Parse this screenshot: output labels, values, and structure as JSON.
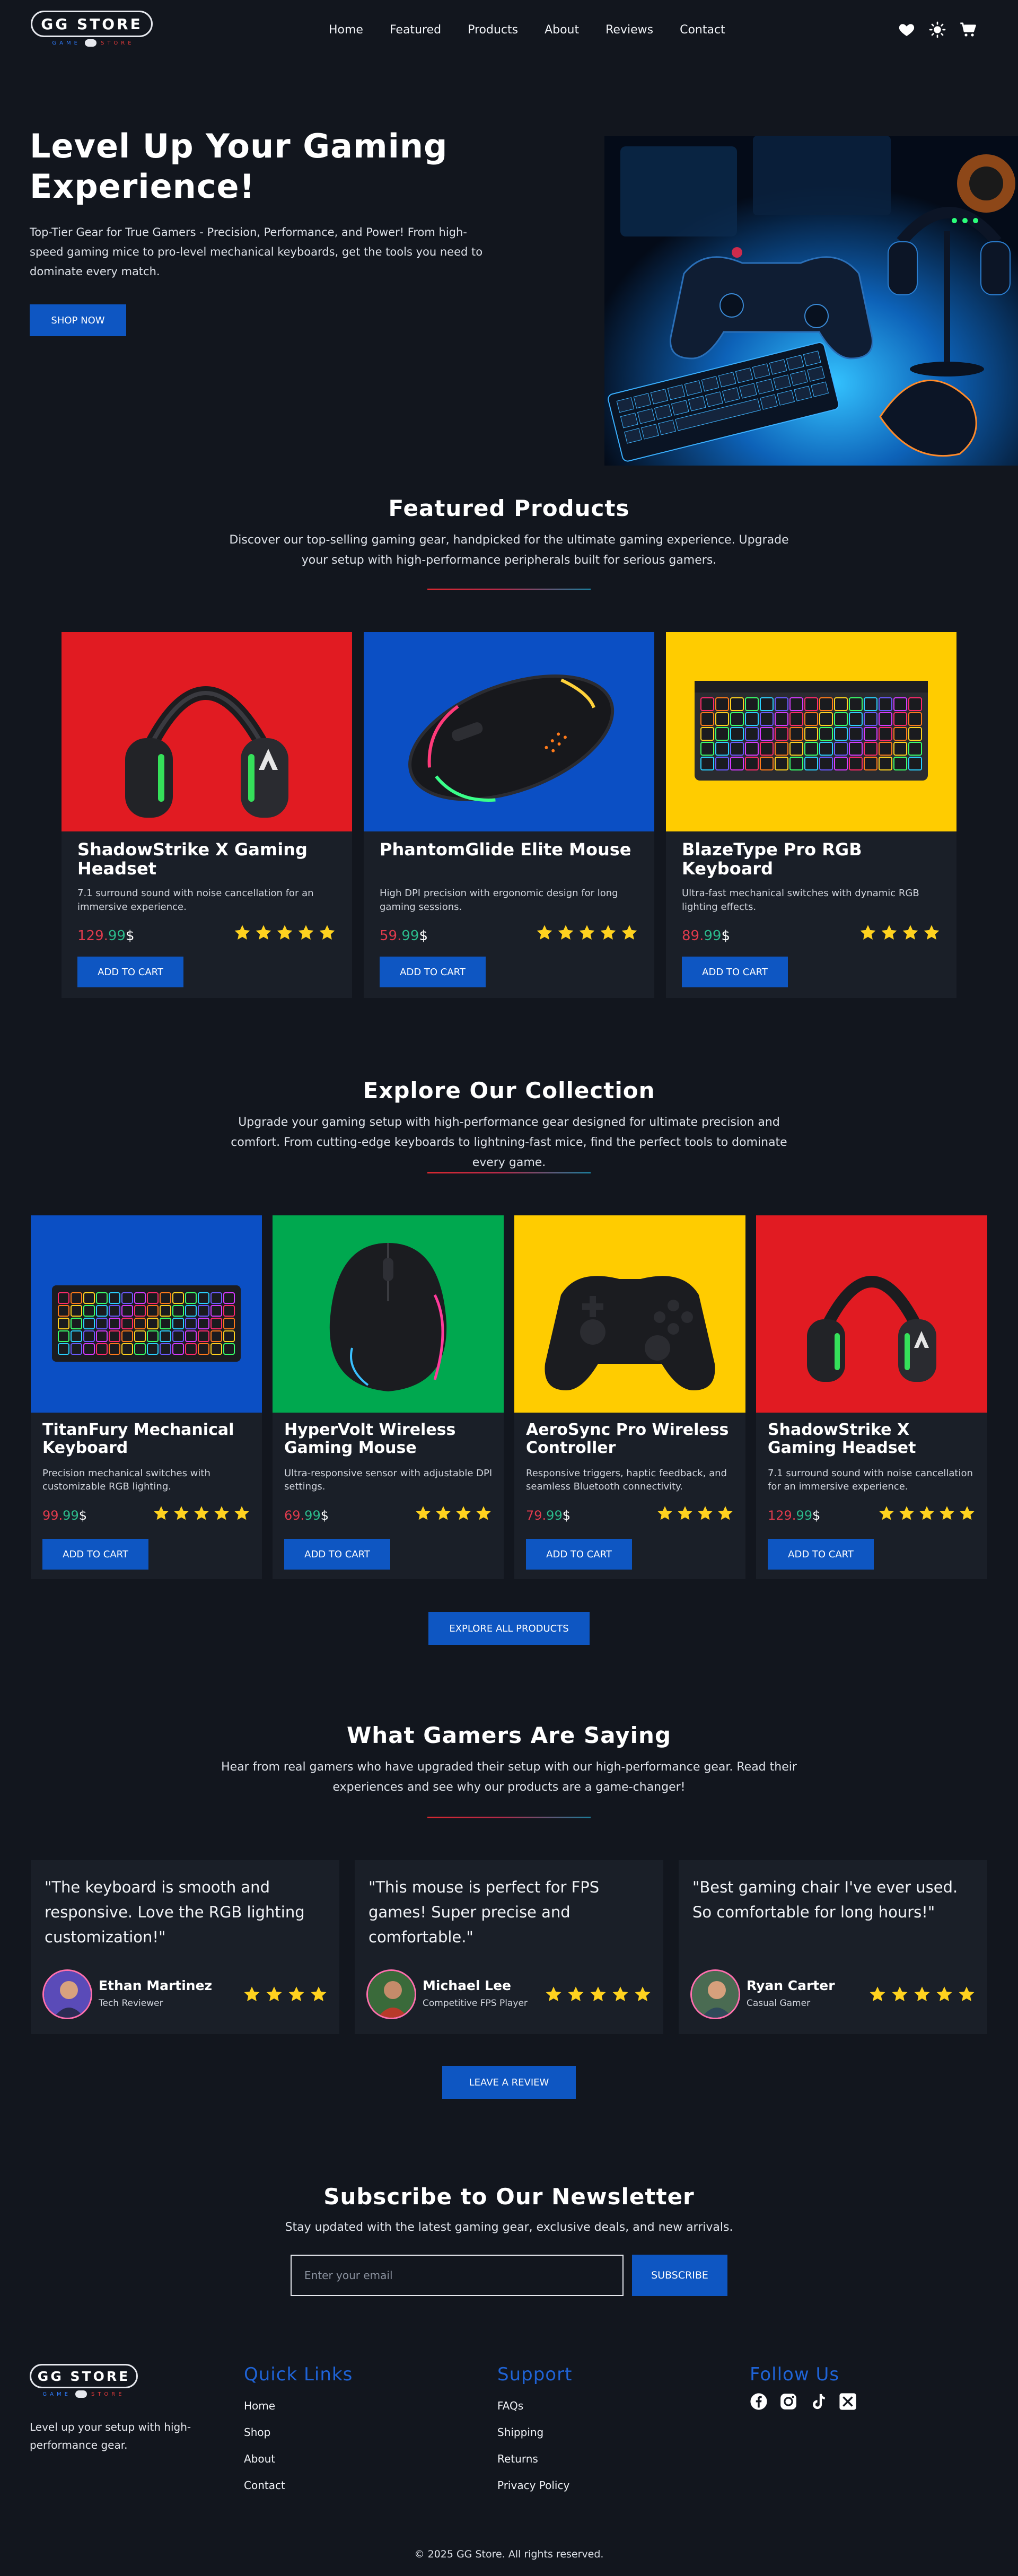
{
  "brand": {
    "name": "GG STORE",
    "sub_left": "GAME",
    "sub_right": "STORE"
  },
  "nav": {
    "links": [
      "Home",
      "Featured",
      "Products",
      "About",
      "Reviews",
      "Contact"
    ],
    "icons": [
      "heart-icon",
      "sun-icon",
      "cart-icon"
    ]
  },
  "hero": {
    "title": "Level Up Your Gaming Experience!",
    "description": "Top-Tier Gear for True Gamers - Precision, Performance, and Power! From high-speed gaming mice to pro-level mechanical keyboards, get the tools you need to dominate every match.",
    "button": "SHOP NOW"
  },
  "featured": {
    "title": "Featured Products",
    "description": "Discover our top-selling gaming gear, handpicked for the ultimate gaming experience. Upgrade your setup with high-performance peripherals built for serious gamers.",
    "products": [
      {
        "name": "ShadowStrike X Gaming Headset",
        "desc": "7.1 surround sound with noise cancellation for an immersive experience.",
        "price_int": "129.",
        "price_dec": "99",
        "currency": "$",
        "stars": 5,
        "button": "ADD TO CART",
        "bg": "#e11b22",
        "product_icon": "headset"
      },
      {
        "name": "PhantomGlide Elite Mouse",
        "desc": "High DPI precision with ergonomic design for long gaming sessions.",
        "price_int": "59.",
        "price_dec": "99",
        "currency": "$",
        "stars": 5,
        "button": "ADD TO CART",
        "bg": "#0b4fc4",
        "product_icon": "mouse"
      },
      {
        "name": "BlazeType Pro RGB Keyboard",
        "desc": "Ultra-fast mechanical switches with dynamic RGB lighting effects.",
        "price_int": "89.",
        "price_dec": "99",
        "currency": "$",
        "stars": 4,
        "button": "ADD TO CART",
        "bg": "#ffcc00",
        "product_icon": "keyboard"
      }
    ]
  },
  "collection": {
    "title": "Explore Our Collection",
    "description": "Upgrade your gaming setup with high-performance gear designed for ultimate precision and comfort. From cutting-edge keyboards to lightning-fast mice, find the perfect tools to dominate every game.",
    "products": [
      {
        "name": "TitanFury Mechanical Keyboard",
        "desc": "Precision mechanical switches with customizable RGB lighting.",
        "price_int": "99.",
        "price_dec": "99",
        "currency": "$",
        "stars": 5,
        "button": "ADD TO CART",
        "bg": "#0b4fc4",
        "product_icon": "keyboard"
      },
      {
        "name": "HyperVolt Wireless Gaming Mouse",
        "desc": "Ultra-responsive sensor with adjustable DPI settings.",
        "price_int": "69.",
        "price_dec": "99",
        "currency": "$",
        "stars": 4,
        "button": "ADD TO CART",
        "bg": "#00a84f",
        "product_icon": "mouse2"
      },
      {
        "name": "AeroSync Pro Wireless Controller",
        "desc": "Responsive triggers, haptic feedback, and seamless Bluetooth connectivity.",
        "price_int": "79.",
        "price_dec": "99",
        "currency": "$",
        "stars": 4,
        "button": "ADD TO CART",
        "bg": "#ffcc00",
        "product_icon": "controller"
      },
      {
        "name": "ShadowStrike X Gaming Headset",
        "desc": "7.1 surround sound with noise cancellation for an immersive experience.",
        "price_int": "129.",
        "price_dec": "99",
        "currency": "$",
        "stars": 5,
        "button": "ADD TO CART",
        "bg": "#e11b22",
        "product_icon": "headset"
      }
    ],
    "button": "EXPLORE ALL PRODUCTS"
  },
  "reviews": {
    "title": "What Gamers Are Saying",
    "description": "Hear from real gamers who have upgraded their setup with our high-performance gear. Read their experiences and see why our products are a game-changer!",
    "items": [
      {
        "quote": "\"The keyboard is smooth and responsive. Love the RGB lighting customization!\"",
        "name": "Ethan Martinez",
        "role": "Tech Reviewer",
        "stars": 4,
        "avatar_color": "#5a4bb8"
      },
      {
        "quote": "\"This mouse is perfect for FPS games! Super precise and comfortable.\"",
        "name": "Michael Lee",
        "role": "Competitive FPS Player",
        "stars": 5,
        "avatar_color": "#3a6a3a"
      },
      {
        "quote": "\"Best gaming chair I've ever used. So comfortable for long hours!\"",
        "name": "Ryan Carter",
        "role": "Casual Gamer",
        "stars": 5,
        "avatar_color": "#4a6b52"
      }
    ],
    "button": "LEAVE A REVIEW"
  },
  "newsletter": {
    "title": "Subscribe to Our Newsletter",
    "description": "Stay updated with the latest gaming gear, exclusive deals, and new arrivals.",
    "placeholder": "Enter your email",
    "button": "SUBSCRIBE"
  },
  "footer": {
    "tagline": "Level up your setup with high-performance gear.",
    "quick_links": {
      "title": "Quick Links",
      "items": [
        "Home",
        "Shop",
        "About",
        "Contact"
      ]
    },
    "support": {
      "title": "Support",
      "items": [
        "FAQs",
        "Shipping",
        "Returns",
        "Privacy Policy"
      ]
    },
    "follow": {
      "title": "Follow Us",
      "icons": [
        "facebook-icon",
        "instagram-icon",
        "tiktok-icon",
        "x-icon"
      ]
    },
    "copyright": "© 2025 GG Store. All rights reserved."
  },
  "colors": {
    "background": "#12161e",
    "card": "#1a1f28",
    "accent_blue": "#0e56c2",
    "star": "#ffd21f",
    "price_red": "#e03b4d",
    "price_green": "#2bbb8c"
  }
}
